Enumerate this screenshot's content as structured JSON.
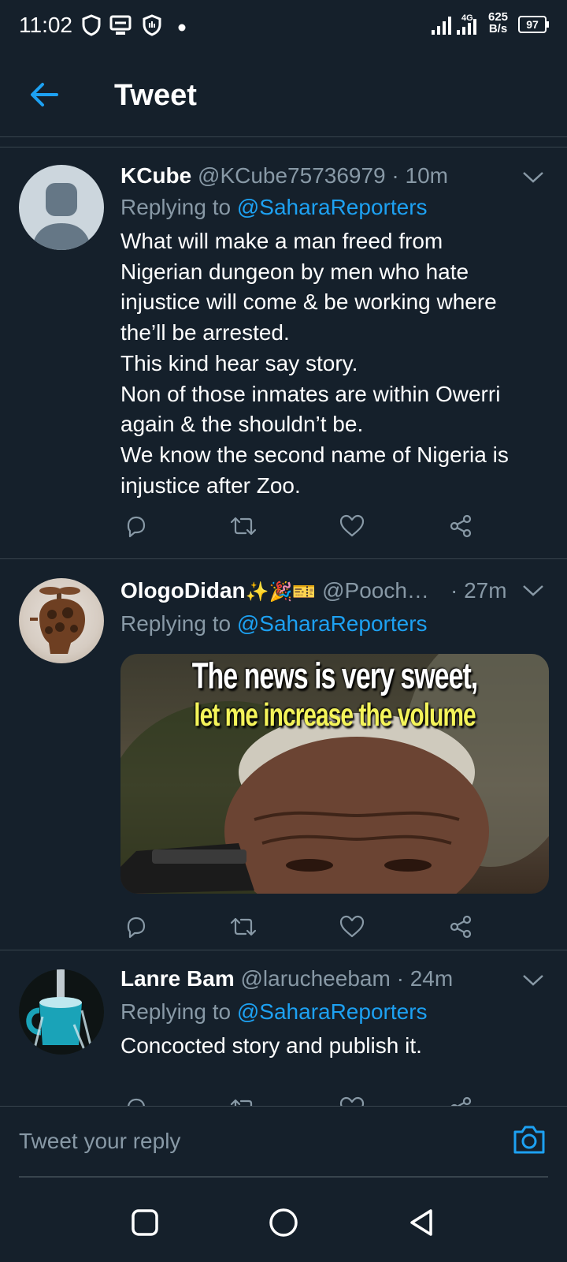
{
  "status": {
    "time": "11:02",
    "network": "4G",
    "speed_value": "625",
    "speed_unit": "B/s",
    "battery": "97"
  },
  "appbar": {
    "title": "Tweet"
  },
  "tweets": [
    {
      "name": "KCube",
      "handle": "@KCube75736979",
      "time": "10m",
      "replying_prefix": "Replying to",
      "replying_to": "@SaharaReporters",
      "lines": [
        "What will make a man freed from",
        "Nigerian dungeon by men who hate",
        "injustice will come & be working where",
        "the’ll be arrested.",
        "This kind hear say story.",
        "Non of those inmates are within Owerri",
        "again & the shouldn’t be.",
        "We know the second name of Nigeria is",
        "injustice after Zoo."
      ]
    },
    {
      "name": "OlogoDidan",
      "emojis": "✨🎉🎫",
      "handle": "@Pooch…",
      "time": "27m",
      "replying_prefix": "Replying to",
      "replying_to": "@SaharaReporters",
      "media": {
        "caption_line1": "The news is very sweet,",
        "caption_line2": "let me increase the volume"
      }
    },
    {
      "name": "Lanre Bam",
      "handle": "@larucheebam",
      "time": "24m",
      "replying_prefix": "Replying to",
      "replying_to": "@SaharaReporters",
      "lines": [
        "Concocted story and  publish it."
      ]
    }
  ],
  "composer": {
    "placeholder": "Tweet your reply"
  },
  "colors": {
    "background": "#15202b",
    "accent": "#1da1f2",
    "secondary_text": "#8899a6",
    "divider": "#38444d"
  },
  "icons": [
    "back-arrow-icon",
    "shield-icon",
    "battery-icon",
    "camera-icon",
    "reply-icon",
    "retweet-icon",
    "like-icon",
    "share-icon",
    "chevron-down-icon",
    "recents-icon",
    "home-icon",
    "back-icon"
  ]
}
